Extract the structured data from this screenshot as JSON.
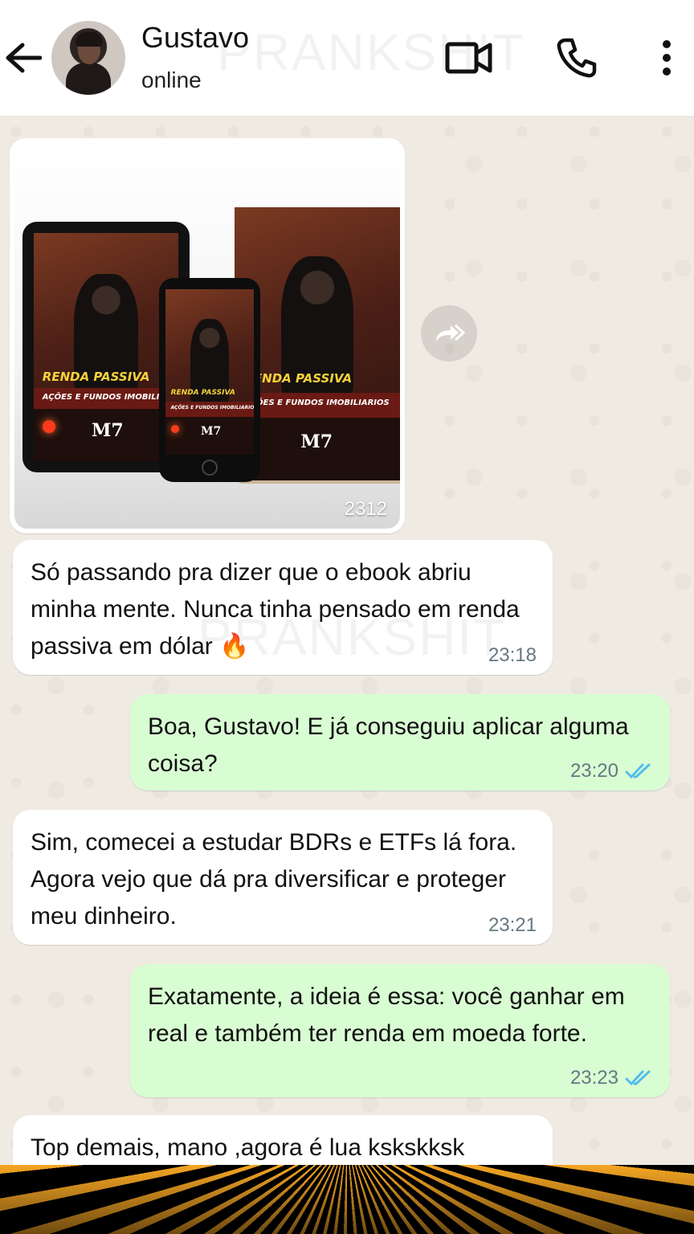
{
  "header": {
    "contact_name": "Gustavo",
    "status": "online",
    "watermark": "PRANKSHIT"
  },
  "icons": {
    "back": "arrow-left-icon",
    "video": "video-camera-icon",
    "call": "phone-icon",
    "menu": "kebab-menu-icon",
    "forward": "forward-icon"
  },
  "image_message": {
    "cover_title": "RENDA PASSIVA",
    "cover_subtitle": "AÇÕES E FUNDOS IMOBILIARIOS",
    "cover_logo": "M7",
    "count": "2312"
  },
  "messages": [
    {
      "direction": "in",
      "text": "Só passando pra dizer que o ebook abriu minha mente. Nunca tinha pensado em renda passiva em dólar 🔥",
      "time": "23:18"
    },
    {
      "direction": "out",
      "text": "Boa, Gustavo! E já conseguiu aplicar alguma coisa?",
      "time": "23:20"
    },
    {
      "direction": "in",
      "text": "Sim, comecei a estudar BDRs e ETFs lá fora. Agora vejo que dá pra diversificar e proteger meu dinheiro.",
      "time": "23:21"
    },
    {
      "direction": "out",
      "text": "Exatamente, a ideia é essa: você ganhar em real e também ter renda em moeda forte.",
      "time": "23:23"
    },
    {
      "direction": "in",
      "text": "Top demais, mano  ,agora é lua kskskksk",
      "time": ""
    }
  ],
  "colors": {
    "chat_bg": "#efeae2",
    "incoming_bubble": "#ffffff",
    "outgoing_bubble": "#d9fdd3",
    "read_ticks": "#53bdeb",
    "time_text": "#667781"
  }
}
